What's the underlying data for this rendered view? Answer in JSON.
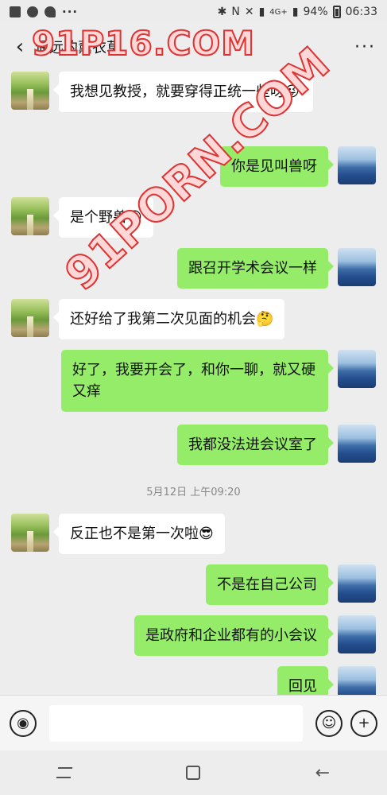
{
  "status_bar": {
    "network": "4G+",
    "battery": "94%",
    "time": "06:33"
  },
  "header": {
    "title": "遥远的薰衣草",
    "more_label": "···"
  },
  "watermark": {
    "top": "91P16.COM",
    "diagonal": "91PORN.COM"
  },
  "messages": [
    {
      "side": "left",
      "text": "我想见教授，就要穿得正统一些呀",
      "emoji": "😜"
    },
    {
      "side": "right",
      "text": "你是见叫兽呀"
    },
    {
      "side": "left",
      "text": "是个野兽",
      "emoji": "😜"
    },
    {
      "side": "right",
      "text": "跟召开学术会议一样"
    },
    {
      "side": "left",
      "text": "还好给了我第二次见面的机会",
      "emoji": "🤔"
    },
    {
      "side": "right",
      "text": "好了，我要开会了，和你一聊，就又硬又痒"
    },
    {
      "side": "right",
      "text": "我都没法进会议室了"
    },
    {
      "side": "left",
      "text": "反正也不是第一次啦",
      "emoji": "😎"
    },
    {
      "side": "right",
      "text": "不是在自己公司"
    },
    {
      "side": "right",
      "text": "是政府和企业都有的小会议"
    },
    {
      "side": "right",
      "text": "回见"
    }
  ],
  "timestamp": "5月12日 上午09:20",
  "input": {
    "placeholder": ""
  },
  "icons": {
    "voice": "voice-icon",
    "emoji": "emoji-icon",
    "plus": "plus-icon"
  }
}
